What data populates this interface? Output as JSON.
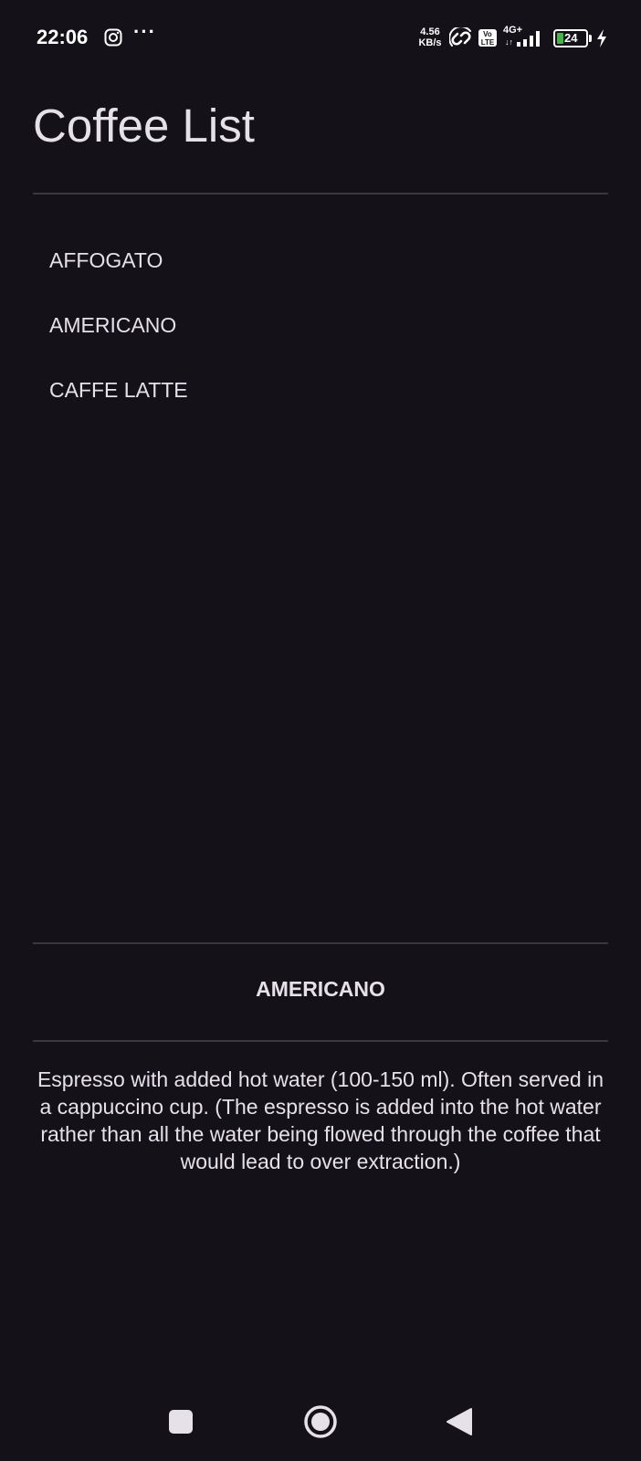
{
  "status_bar": {
    "time": "22:06",
    "more": "···",
    "speed_value": "4.56",
    "speed_unit": "KB/s",
    "volte_top": "Vo",
    "volte_bottom": "LTE",
    "network": "4G+",
    "network_arrows": "↓↑",
    "battery": "24",
    "icons": [
      "instagram-icon",
      "hotspot-icon",
      "volte-icon",
      "signal-icon",
      "battery-icon",
      "charging-icon"
    ],
    "battery_color": "#4caf50"
  },
  "app": {
    "title": "Coffee List"
  },
  "coffee_list": {
    "items": [
      "AFFOGATO",
      "AMERICANO",
      "CAFFE LATTE"
    ]
  },
  "detail": {
    "title": "AMERICANO",
    "description": "Espresso with added hot water (100-150 ml). Often served in a cappuccino cup. (The espresso is added into the hot water rather than all the water being flowed through the coffee that would lead to over extraction.)"
  },
  "nav_bar": {
    "icons": [
      "recents-icon",
      "home-icon",
      "back-icon"
    ]
  },
  "colors": {
    "background": "#141218",
    "text": "#e6e0e9",
    "divider": "#3a373f"
  }
}
